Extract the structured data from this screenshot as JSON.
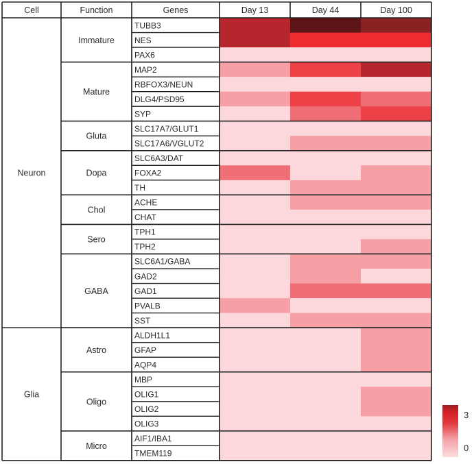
{
  "chart_data": {
    "type": "heatmap",
    "title": "",
    "column_headers": [
      "Cell",
      "Function",
      "Genes",
      "Day 13",
      "Day 44",
      "Day 100"
    ],
    "x": [
      "Day 13",
      "Day 44",
      "Day 100"
    ],
    "cells": [
      {
        "label": "Neuron",
        "functions": [
          {
            "label": "Immature",
            "genes": [
              "TUBB3",
              "NES",
              "PAX6"
            ]
          },
          {
            "label": "Mature",
            "genes": [
              "MAP2",
              "RBFOX3/NEUN",
              "DLG4/PSD95",
              "SYP"
            ]
          },
          {
            "label": "Gluta",
            "genes": [
              "SLC17A7/GLUT1",
              "SLC17A6/VGLUT2"
            ]
          },
          {
            "label": "Dopa",
            "genes": [
              "SLC6A3/DAT",
              "FOXA2",
              "TH"
            ]
          },
          {
            "label": "Chol",
            "genes": [
              "ACHE",
              "CHAT"
            ]
          },
          {
            "label": "Sero",
            "genes": [
              "TPH1",
              "TPH2"
            ]
          },
          {
            "label": "GABA",
            "genes": [
              "SLC6A1/GABA",
              "GAD2",
              "GAD1",
              "PVALB",
              "SST"
            ]
          }
        ]
      },
      {
        "label": "Glia",
        "functions": [
          {
            "label": "Astro",
            "genes": [
              "ALDH1L1",
              "GFAP",
              "AQP4"
            ]
          },
          {
            "label": "Oligo",
            "genes": [
              "MBP",
              "OLIG1",
              "OLIG2",
              "OLIG3"
            ]
          },
          {
            "label": "Micro",
            "genes": [
              "AIF1/IBA1",
              "TMEM119"
            ]
          }
        ]
      }
    ],
    "values": {
      "TUBB3": [
        2.7,
        3.0,
        2.8
      ],
      "NES": [
        2.7,
        2.4,
        2.4
      ],
      "PAX6": [
        0,
        0,
        0
      ],
      "MAP2": [
        1,
        2,
        2.7
      ],
      "RBFOX3/NEUN": [
        0,
        0,
        0
      ],
      "DLG4/PSD95": [
        1,
        2,
        1.5
      ],
      "SYP": [
        0,
        1.5,
        2
      ],
      "SLC17A7/GLUT1": [
        0,
        0,
        0
      ],
      "SLC17A6/VGLUT2": [
        0,
        1,
        1
      ],
      "SLC6A3/DAT": [
        0,
        0,
        0
      ],
      "FOXA2": [
        1.5,
        0,
        1
      ],
      "TH": [
        0,
        1,
        1
      ],
      "ACHE": [
        0,
        1,
        1
      ],
      "CHAT": [
        0,
        0,
        0
      ],
      "TPH1": [
        0,
        0,
        0
      ],
      "TPH2": [
        0,
        0,
        1
      ],
      "SLC6A1/GABA": [
        0,
        1,
        1
      ],
      "GAD2": [
        0,
        1,
        0
      ],
      "GAD1": [
        0,
        1.5,
        1.5
      ],
      "PVALB": [
        1,
        0,
        0
      ],
      "SST": [
        0,
        1,
        1
      ],
      "ALDH1L1": [
        0,
        0,
        1
      ],
      "GFAP": [
        0,
        0,
        1
      ],
      "AQP4": [
        0,
        0,
        1
      ],
      "MBP": [
        0,
        0,
        0
      ],
      "OLIG1": [
        0,
        0,
        1
      ],
      "OLIG2": [
        0,
        0,
        1
      ],
      "OLIG3": [
        0,
        0,
        0
      ],
      "AIF1/IBA1": [
        0,
        0,
        0
      ],
      "TMEM119": [
        0,
        0,
        0
      ]
    },
    "colorbar": {
      "min": 0,
      "max": 3,
      "tick_labels": [
        "3",
        "0"
      ],
      "placement": "bottom-right"
    },
    "color_scale": [
      {
        "value": 0,
        "color": "#fcd8dc"
      },
      {
        "value": 1,
        "color": "#f6a0a6"
      },
      {
        "value": 1.5,
        "color": "#f06e76"
      },
      {
        "value": 2,
        "color": "#ec4146"
      },
      {
        "value": 2.4,
        "color": "#ee2b2f"
      },
      {
        "value": 2.7,
        "color": "#b7262d"
      },
      {
        "value": 2.8,
        "color": "#8a2224"
      },
      {
        "value": 3,
        "color": "#5c1416"
      }
    ]
  }
}
